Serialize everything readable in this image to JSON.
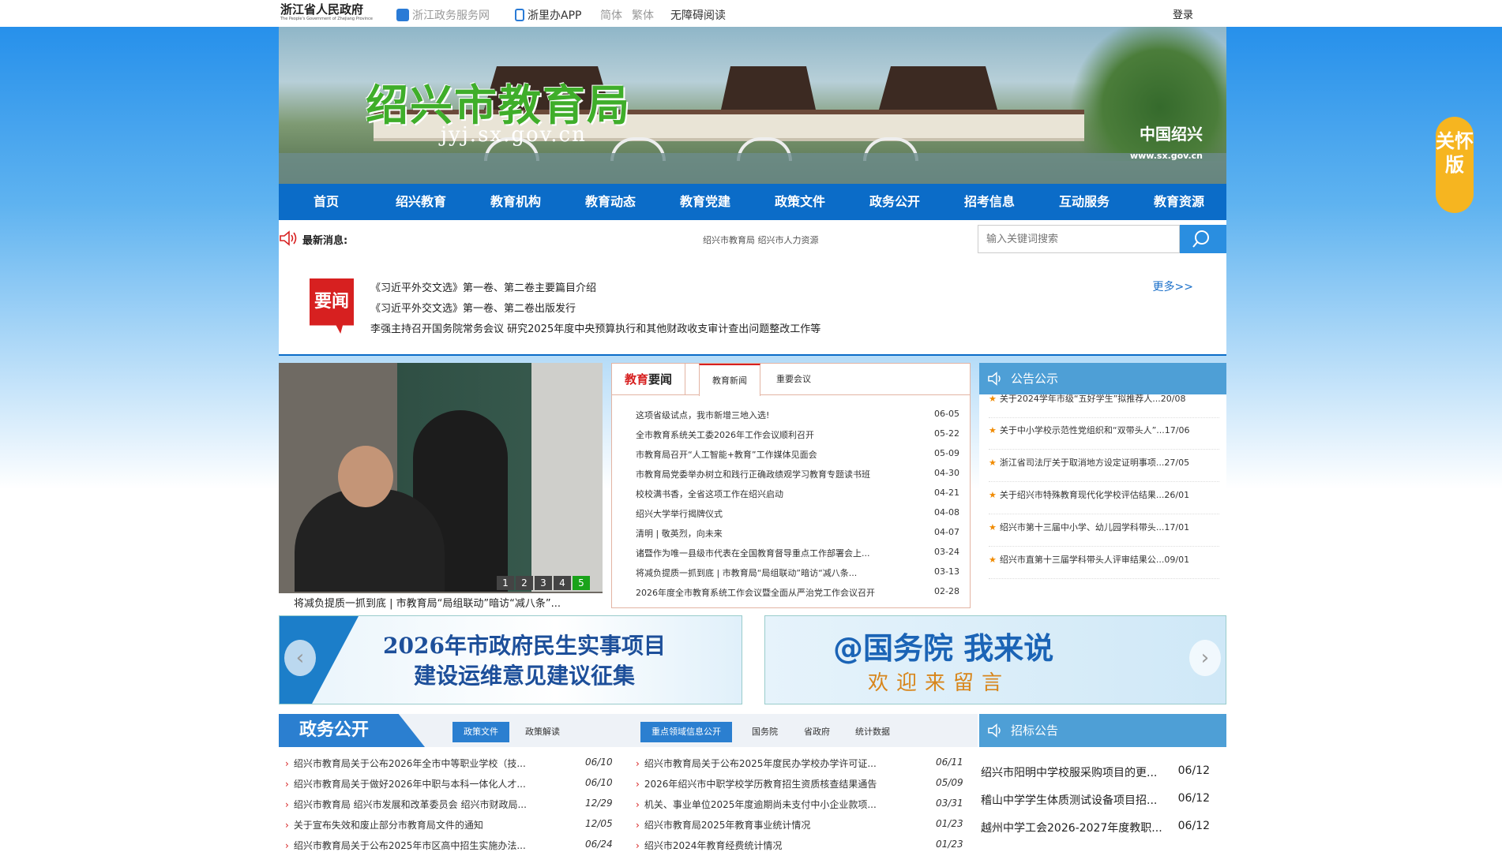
{
  "topbar": {
    "logo_cn": "浙江省人民政府",
    "logo_en": "The People's Government of Zhejiang Province",
    "links": [
      "浙江政务服务网",
      "浙里办APP",
      "简体",
      "繁体",
      "无障碍阅读"
    ],
    "login": "登录"
  },
  "banner": {
    "title": "绍兴市教育局",
    "domain": "jyj.sx.gov.cn",
    "city_name": "中国绍兴",
    "city_url": "www.sx.gov.cn"
  },
  "nav": [
    "首页",
    "绍兴教育",
    "教育机构",
    "教育动态",
    "教育党建",
    "政策文件",
    "政务公开",
    "招考信息",
    "互动服务",
    "教育资源"
  ],
  "newsline": {
    "label": "最新消息:",
    "ticker": "绍兴市教育局 绍兴市人力资源",
    "search_placeholder": "输入关键词搜索"
  },
  "headlines": {
    "badge": "要闻",
    "more": "更多>>",
    "items": [
      "《习近平外交文选》第一卷、第二卷主要篇目介绍",
      "《习近平外交文选》第一卷、第二卷出版发行",
      "李强主持召开国务院常务会议 研究2025年度中央预算执行和其他财政收支审计查出问题整改工作等"
    ]
  },
  "photo": {
    "pages": [
      "1",
      "2",
      "3",
      "4",
      "5"
    ],
    "active_page": "5",
    "caption": "将减负提质一抓到底 | 市教育局“局组联动”暗访“减八条”..."
  },
  "edunews": {
    "tab_main_red": "教育",
    "tab_main_rest": "要闻",
    "tabs": [
      "教育新闻",
      "重要会议"
    ],
    "items": [
      {
        "title": "这项省级试点，我市新增三地入选!",
        "date": "06-05"
      },
      {
        "title": "全市教育系统关工委2026年工作会议顺利召开",
        "date": "05-22"
      },
      {
        "title": "市教育局召开“人工智能+教育”工作媒体见面会",
        "date": "05-09"
      },
      {
        "title": "市教育局党委举办树立和践行正确政绩观学习教育专题读书班",
        "date": "04-30"
      },
      {
        "title": "校校满书香，全省这项工作在绍兴启动",
        "date": "04-21"
      },
      {
        "title": "绍兴大学举行揭牌仪式",
        "date": "04-08"
      },
      {
        "title": "清明 | 敬英烈，向未来",
        "date": "04-07"
      },
      {
        "title": "诸暨作为唯一县级市代表在全国教育督导重点工作部署会上...",
        "date": "03-24"
      },
      {
        "title": "将减负提质一抓到底 | 市教育局“局组联动”暗访“减八条...",
        "date": "03-13"
      },
      {
        "title": "2026年度全市教育系统工作会议暨全面从严治党工作会议召开",
        "date": "02-28"
      }
    ]
  },
  "notice": {
    "title": "公告公示",
    "items": [
      {
        "title": "关于2024学年市级“五好学生”拟推荐人...",
        "date": "20/08"
      },
      {
        "title": "关于中小学校示范性党组织和“双带头人”...",
        "date": "17/06"
      },
      {
        "title": "浙江省司法厅关于取消地方设定证明事项...",
        "date": "27/05"
      },
      {
        "title": "关于绍兴市特殊教育现代化学校评估结果...",
        "date": "26/01"
      },
      {
        "title": "绍兴市第十三届中小学、幼儿园学科带头...",
        "date": "17/01"
      },
      {
        "title": "绍兴市直第十三届学科带头人评审结果公...",
        "date": "09/01"
      }
    ]
  },
  "promos": {
    "p1_line1": "2026年市政府民生实事项目",
    "p1_line2": "建设运维意见建议征集",
    "p2_line1": "@国务院 我来说",
    "p2_line2": "欢迎来留言"
  },
  "gov": {
    "title": "政务公开",
    "tabs_left": [
      "政策文件",
      "政策解读"
    ],
    "tabs_right": [
      "重点领域信息公开",
      "国务院",
      "省政府",
      "统计数据"
    ],
    "left_items": [
      {
        "title": "绍兴市教育局关于公布2026年全市中等职业学校（技...",
        "date": "06/10"
      },
      {
        "title": "绍兴市教育局关于做好2026年中职与本科一体化人才...",
        "date": "06/10"
      },
      {
        "title": "绍兴市教育局 绍兴市发展和改革委员会 绍兴市财政局...",
        "date": "12/29"
      },
      {
        "title": "关于宣布失效和废止部分市教育局文件的通知",
        "date": "12/05"
      },
      {
        "title": "绍兴市教育局关于公布2025年市区高中招生实施办法...",
        "date": "06/24"
      }
    ],
    "right_items": [
      {
        "title": "绍兴市教育局关于公布2025年度民办学校办学许可证...",
        "date": "06/11"
      },
      {
        "title": "2026年绍兴市中职学校学历教育招生资质核查结果通告",
        "date": "05/09"
      },
      {
        "title": "机关、事业单位2025年度逾期尚未支付中小企业款项...",
        "date": "03/31"
      },
      {
        "title": "绍兴市教育局2025年教育事业统计情况",
        "date": "01/23"
      },
      {
        "title": "绍兴市2024年教育经费统计情况",
        "date": "01/23"
      }
    ]
  },
  "bid": {
    "title": "招标公告",
    "items": [
      {
        "title": "绍兴市阳明中学校服采购项目的更...",
        "date": "06/12"
      },
      {
        "title": "稽山中学学生体质测试设备项目招...",
        "date": "06/12"
      },
      {
        "title": "越州中学工会2026-2027年度教职...",
        "date": "06/12"
      }
    ]
  },
  "care": "关怀版"
}
